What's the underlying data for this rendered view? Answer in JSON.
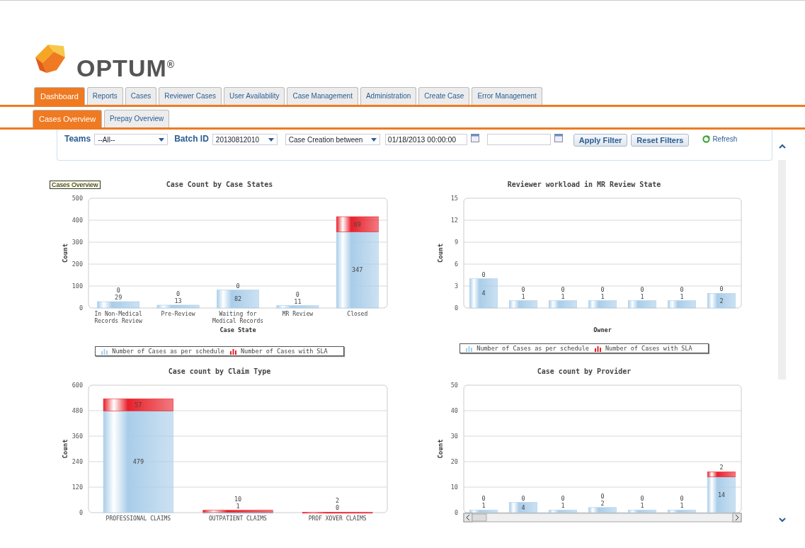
{
  "logo": {
    "text": "OPTUM$^{®}$"
  },
  "tabs": [
    {
      "label": "Dashboard",
      "selected": true
    },
    {
      "label": "Reports",
      "selected": false
    },
    {
      "label": "Cases",
      "selected": false
    },
    {
      "label": "Reviewer Cases",
      "selected": false
    },
    {
      "label": "User Availability",
      "selected": false
    },
    {
      "label": "Case Management",
      "selected": false
    },
    {
      "label": "Administration",
      "selected": false
    },
    {
      "label": "Create Case",
      "selected": false
    },
    {
      "label": "Error Management",
      "selected": false
    }
  ],
  "subtabs": [
    {
      "label": "Cases Overview",
      "selected": true
    },
    {
      "label": "Prepay Overview",
      "selected": false
    }
  ],
  "filters": {
    "teams_label": "Teams",
    "teams_value": "--All--",
    "batch_label": "Batch ID",
    "batch_value": "20130812010",
    "date_mode": "Case Creation between",
    "date_from": "01/18/2013 00:00:00",
    "apply": "Apply Filter",
    "reset": "Reset Filters",
    "refresh": "Refresh"
  },
  "charts": [
    {
      "tooltip": "Cases Overview",
      "show_legend": true,
      "chart_data": {
        "type": "bar",
        "stacked": true,
        "grid": true,
        "title": "Case Count by Case States",
        "xlabel": "Case State",
        "ylabel": "Count",
        "categories": [
          "In Non-Medical Records Review",
          "Pre-Review",
          "Waiting for Medical Records",
          "MR Review",
          "Closed"
        ],
        "ylim": [
          0,
          500
        ],
        "yticks": [
          0,
          100,
          200,
          300,
          400,
          500
        ],
        "data_labels": true,
        "series": [
          {
            "name": "Number of Cases as per schedule",
            "color": "#a9cde9",
            "values": [
              29,
              13,
              82,
              11,
              347
            ]
          },
          {
            "name": "Number of Cases with SLA",
            "color": "#e8202a",
            "values": [
              0,
              0,
              0,
              0,
              69
            ]
          }
        ]
      }
    },
    {
      "show_legend": true,
      "chart_data": {
        "type": "bar",
        "stacked": true,
        "grid": true,
        "title": "Reviewer workload in MR Review State",
        "xlabel": "Owner",
        "ylabel": "Count",
        "ylim": [
          0,
          15
        ],
        "yticks": [
          0,
          3,
          6,
          9,
          12,
          15
        ],
        "data_labels": true,
        "series": [
          {
            "name": "Number of Cases as per schedule",
            "color": "#a9cde9",
            "values": [
              4,
              1,
              1,
              1,
              1,
              1,
              2
            ]
          },
          {
            "name": "Number of Cases with SLA",
            "color": "#e8202a",
            "values": [
              0,
              0,
              0,
              0,
              0,
              0,
              0
            ]
          }
        ]
      }
    },
    {
      "chart_data": {
        "type": "bar",
        "stacked": true,
        "grid": true,
        "title": "Case count by Claim Type",
        "ylabel": "Count",
        "categories": [
          "PROFESSIONAL CLAIMS",
          "OUTPATIENT CLAIMS",
          "PROF XOVER CLAIMS"
        ],
        "ylim": [
          0,
          600
        ],
        "yticks": [
          0,
          120,
          240,
          360,
          480,
          600
        ],
        "data_labels": true,
        "series": [
          {
            "color": "#a9cde9",
            "values": [
              479,
              1,
              0
            ]
          },
          {
            "color": "#e8202a",
            "values": [
              57,
              10,
              2
            ]
          }
        ]
      }
    },
    {
      "horizontal_scroll": true,
      "chart_data": {
        "type": "bar",
        "stacked": true,
        "grid": true,
        "title": "Case count by Provider",
        "ylabel": "Count",
        "ylim": [
          0,
          50
        ],
        "yticks": [
          0,
          10,
          20,
          30,
          40,
          50
        ],
        "data_labels": true,
        "series": [
          {
            "color": "#a9cde9",
            "values": [
              1,
              4,
              1,
              2,
              1,
              1,
              14
            ]
          },
          {
            "color": "#e8202a",
            "values": [
              0,
              0,
              0,
              0,
              0,
              0,
              2
            ]
          }
        ]
      }
    }
  ]
}
